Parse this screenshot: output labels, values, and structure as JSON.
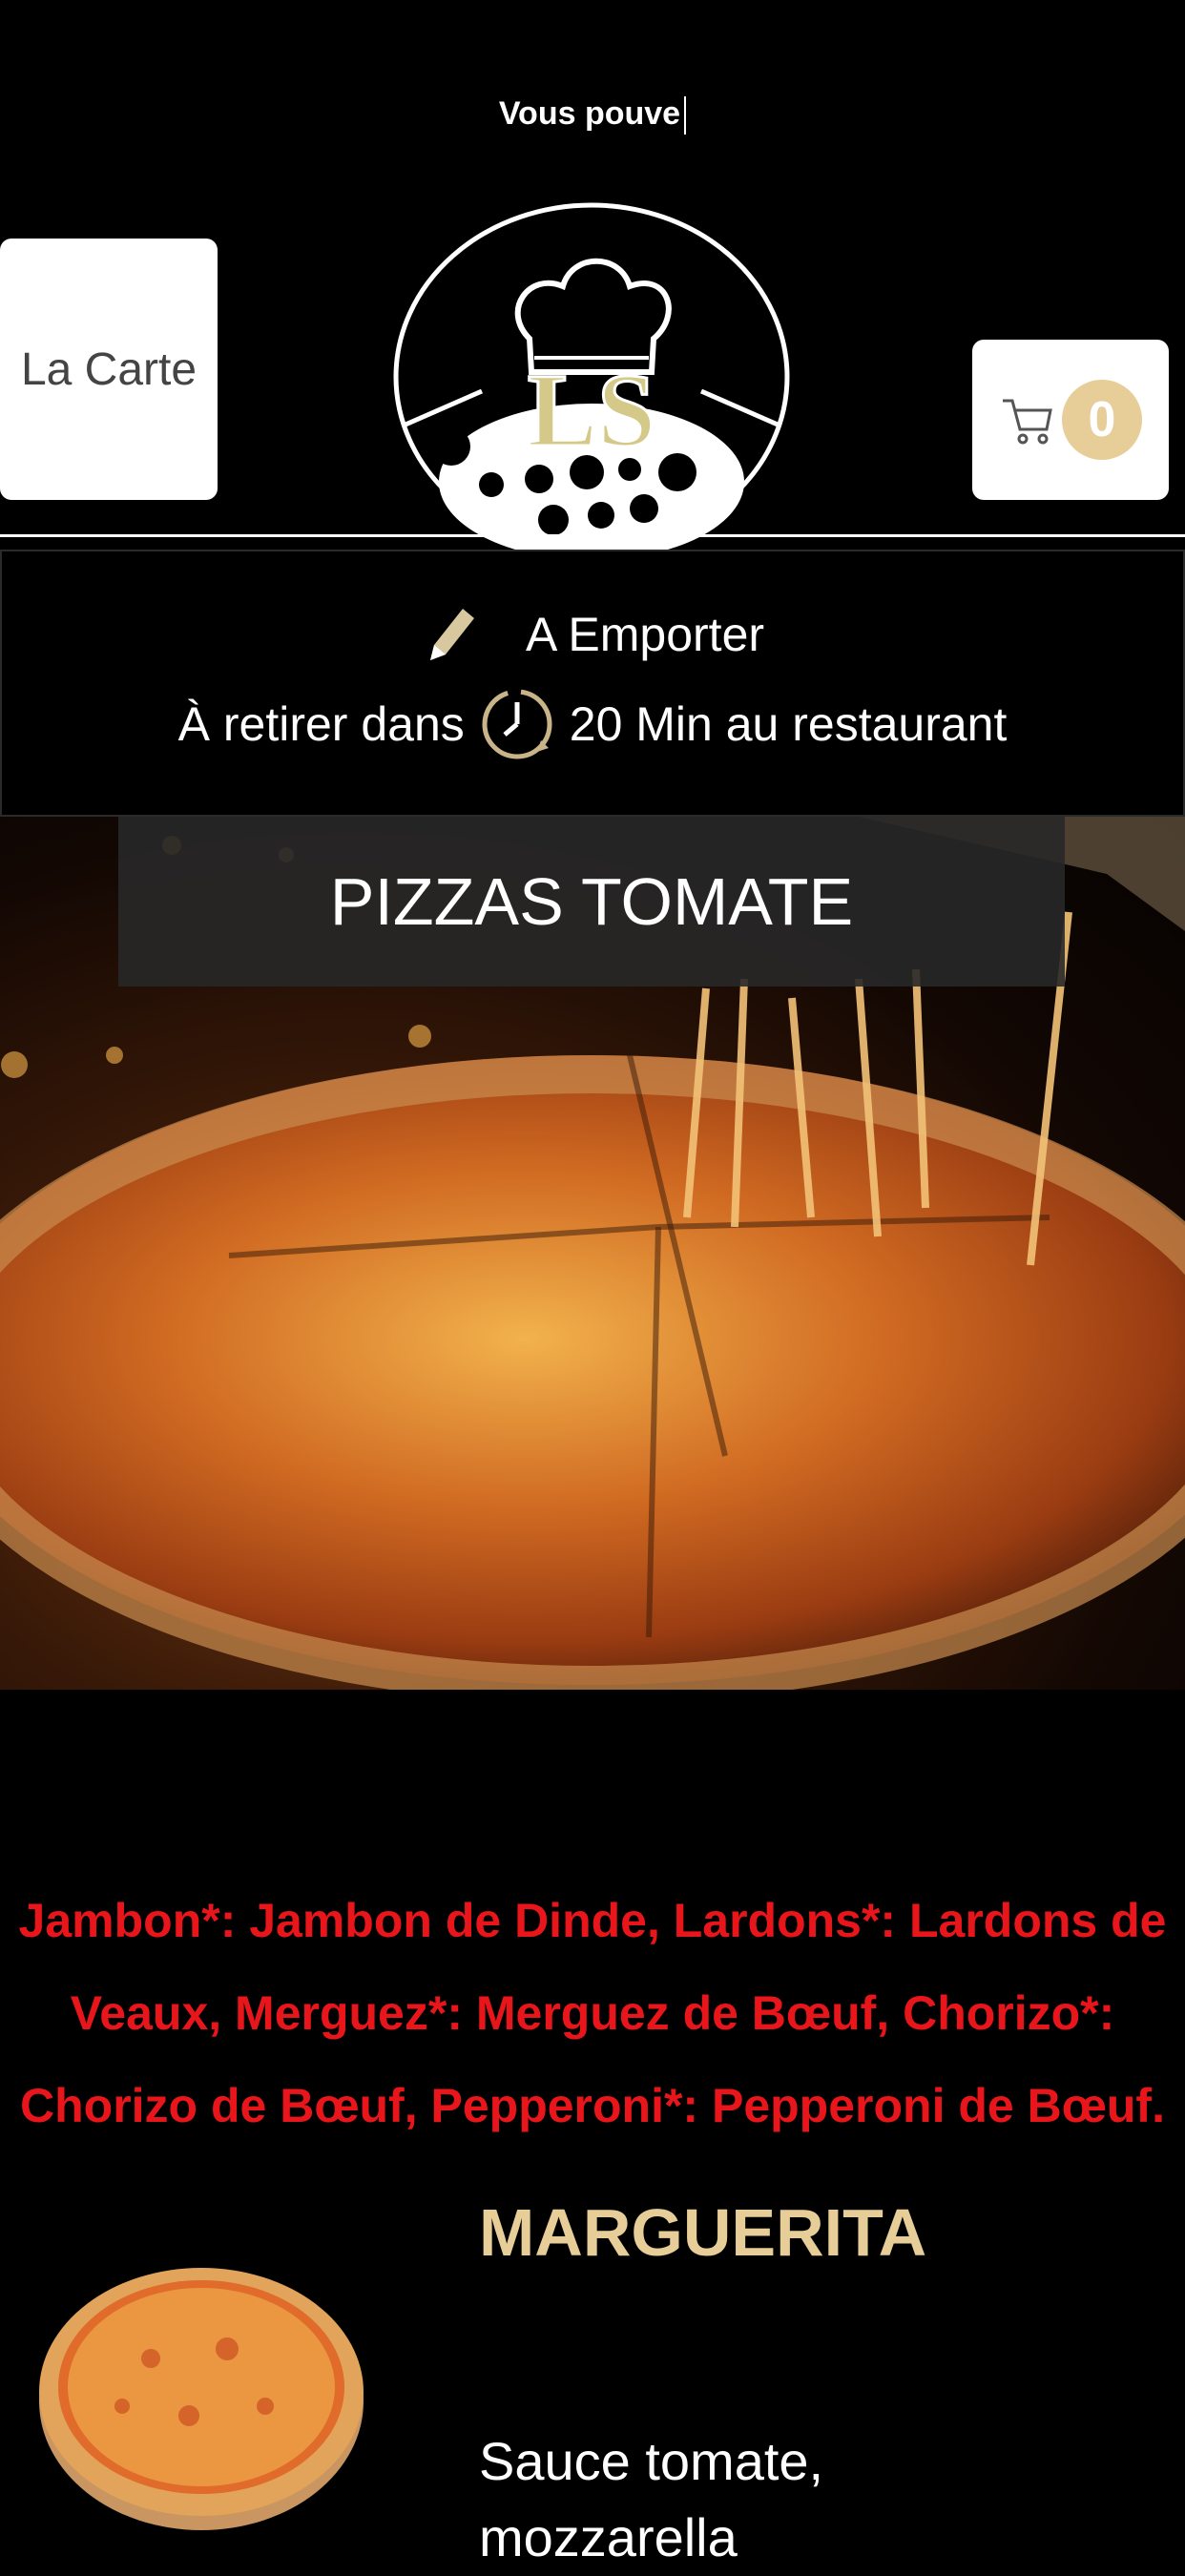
{
  "header": {
    "ticker_text": "Vous pouve",
    "carte_button": "La Carte",
    "cart_count": "0",
    "icons": {
      "cart": "cart-icon",
      "logo": "ls-chef-logo"
    }
  },
  "mode": {
    "title": "A Emporter",
    "pickup_prefix": "À retirer dans",
    "pickup_time": "20 Min au restaurant",
    "icons": {
      "edit": "pencil-icon",
      "time": "clock-icon"
    }
  },
  "hero": {
    "category_title": "PIZZAS TOMATE"
  },
  "allergen_note": "Jambon*: Jambon de Dinde, Lardons*: Lardons de Veaux, Merguez*: Merguez de Bœuf, Chorizo*: Chorizo de Bœuf, Pepperoni*: Pepperoni de Bœuf.",
  "product": {
    "name": "MARGUERITA",
    "description": "Sauce tomate, mozzarella"
  },
  "colors": {
    "accent_gold": "#e7cd98",
    "note_red": "#e8151b",
    "background": "#000000"
  }
}
